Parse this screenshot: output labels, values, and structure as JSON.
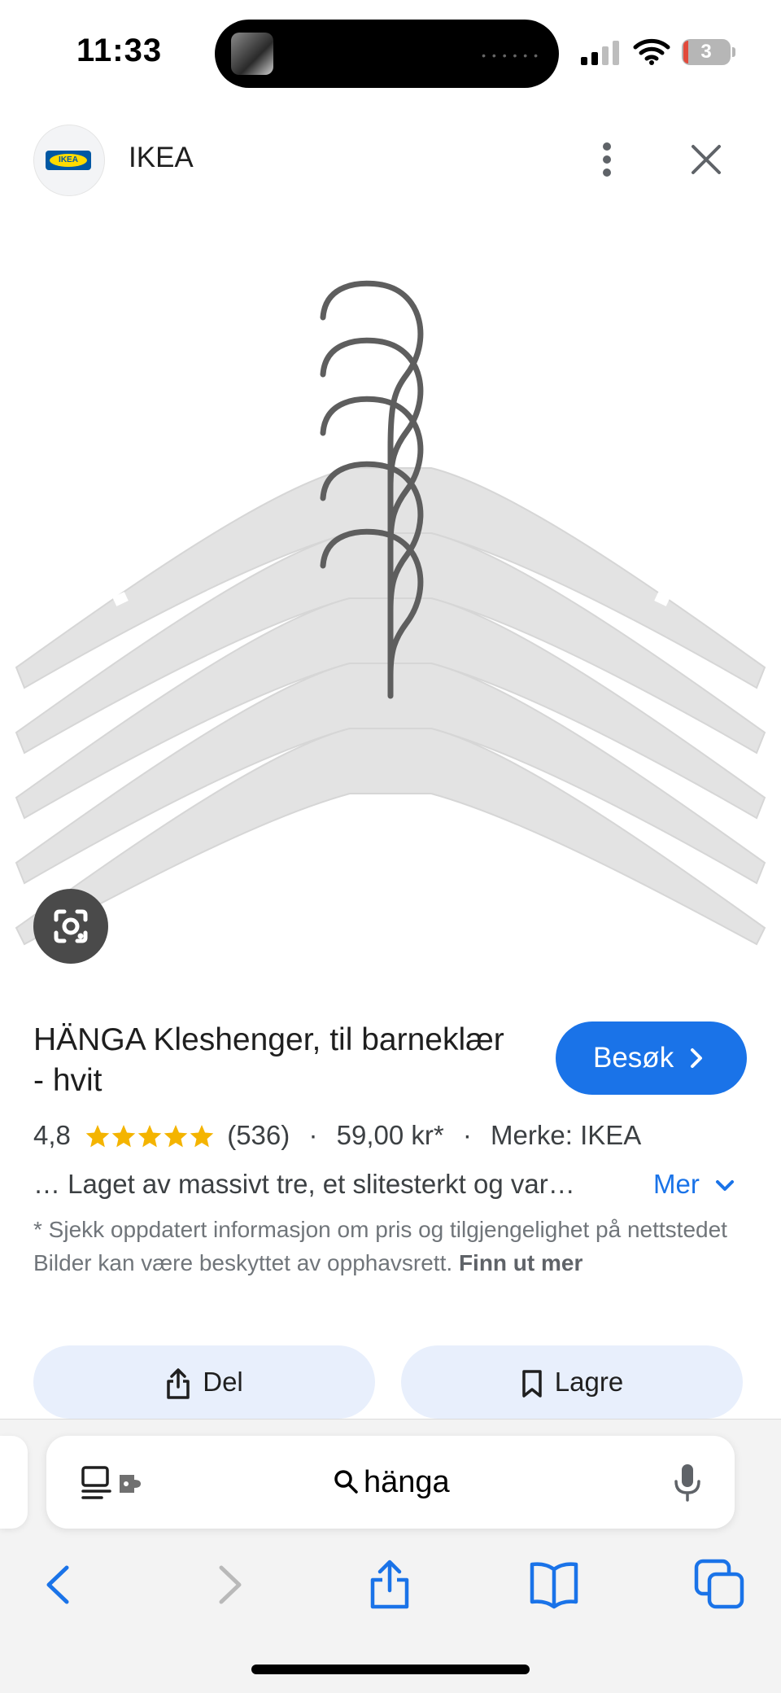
{
  "status_bar": {
    "time": "11:33",
    "battery_level": "3",
    "icons": [
      "signal-icon",
      "wifi-icon",
      "battery-icon"
    ]
  },
  "header": {
    "site_name": "IKEA",
    "logo_text": "IKEA",
    "icons": [
      "more-vertical-icon",
      "close-icon"
    ]
  },
  "product": {
    "title": "HÄNGA Kleshenger, til barneklær - hvit",
    "visit_label": "Besøk",
    "rating": "4,8",
    "rating_stars": 5,
    "review_count": "(536)",
    "price": "59,00 kr*",
    "brand": "Merke: IKEA",
    "separator": "·",
    "snippet": "… Laget av massivt tre, et slitesterkt og var…",
    "more_label": "Mer",
    "disclaimer": "* Sjekk oppdatert informasjon om pris og tilgjengelighet på nettstedet Bilder kan være beskyttet av opphavsrett.",
    "disclaimer_link": "Finn ut mer",
    "share_label": "Del",
    "save_label": "Lagre"
  },
  "browser": {
    "search_query": "hänga",
    "toolbar": [
      "back-icon",
      "forward-icon",
      "share-icon",
      "bookmarks-icon",
      "tabs-icon"
    ]
  },
  "colors": {
    "accent_blue": "#1a73e8",
    "star_gold": "#f4b400",
    "chip_bg": "#e8effc",
    "ikea_blue": "#0058a3",
    "ikea_yellow": "#ffdb00"
  }
}
